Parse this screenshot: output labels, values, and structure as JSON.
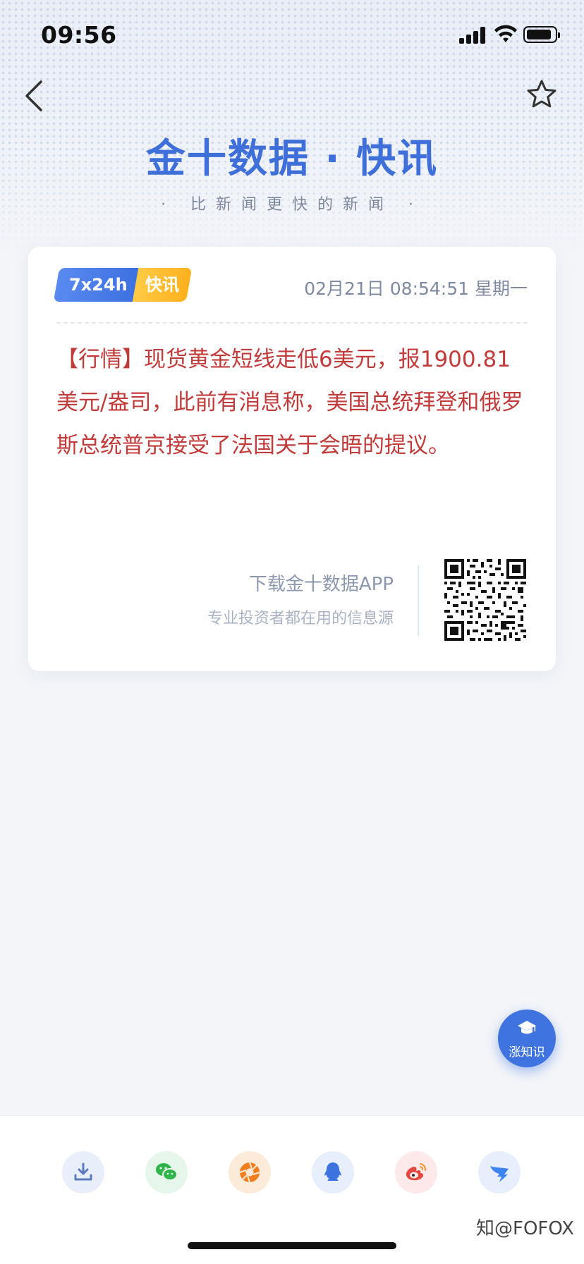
{
  "status_bar": {
    "time": "09:56"
  },
  "header": {
    "brand": "金十数据 · 快讯",
    "slogan": "· 比新闻更快的新闻 ·"
  },
  "card": {
    "badge_left": "7x24h",
    "badge_right": "快讯",
    "datetime": "02月21日 08:54:51 星期一",
    "news_text": "【行情】现货黄金短线走低6美元，报1900.81美元/盎司，此前有消息称，美国总统拜登和俄罗斯总统普京接受了法国关于会晤的提议。",
    "download_title": "下载金十数据APP",
    "download_sub": "专业投资者都在用的信息源"
  },
  "fab": {
    "label": "涨知识"
  },
  "share": [
    {
      "name": "download-icon",
      "bg": "#e9effa",
      "color": "#5a7bbd"
    },
    {
      "name": "wechat-icon",
      "bg": "#e6f6ea",
      "color": "#2fb54a"
    },
    {
      "name": "moments-icon",
      "bg": "#fdebd9",
      "color": "#f07d1e"
    },
    {
      "name": "qq-icon",
      "bg": "#e7eefc",
      "color": "#3d73e0"
    },
    {
      "name": "weibo-icon",
      "bg": "#fde9e9",
      "color": "#e2483d"
    },
    {
      "name": "dingtalk-icon",
      "bg": "#e7eefc",
      "color": "#3d83f2"
    }
  ],
  "watermark": "知@FOFOX"
}
